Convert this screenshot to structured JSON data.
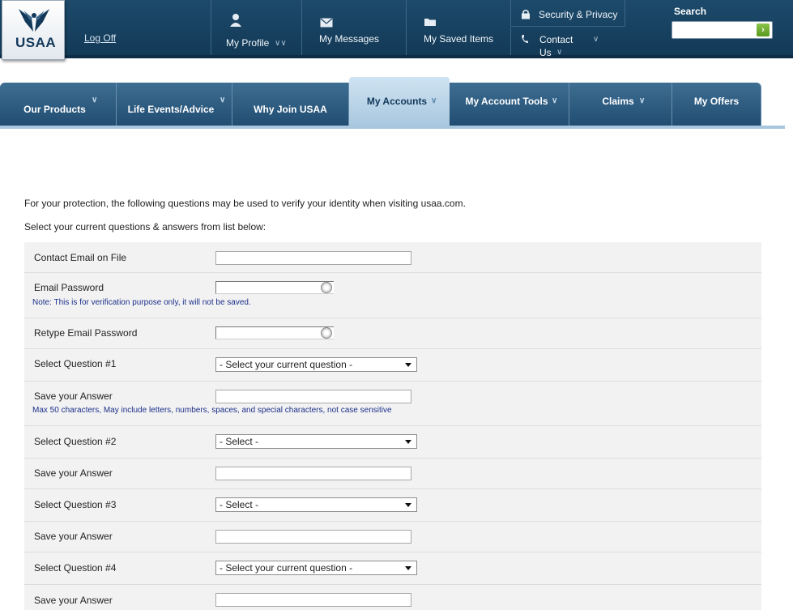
{
  "header": {
    "logo_text": "USAA",
    "logoff_label": "Log Off",
    "nav": [
      {
        "label": "My Profile",
        "icon": "person-icon"
      },
      {
        "label": "My Messages",
        "icon": "envelope-icon"
      },
      {
        "label": "My Saved Items",
        "icon": "folder-icon"
      },
      {
        "label": "Security & Privacy",
        "icon": "lock-icon"
      },
      {
        "label_line1": "Contact",
        "label_line2": "Us",
        "icon": "phone-icon"
      }
    ],
    "search_label": "Search",
    "search_value": ""
  },
  "tabs": [
    {
      "label": "Our Products"
    },
    {
      "label": "Life Events/Advice"
    },
    {
      "label": "Why Join USAA"
    },
    {
      "label": "My Accounts",
      "active": true
    },
    {
      "label": "My Account Tools"
    },
    {
      "label": "Claims"
    },
    {
      "label": "My Offers"
    }
  ],
  "intro": {
    "line1": "For your protection, the following questions may be used to verify your identity when visiting usaa.com.",
    "line2": "Select your current questions & answers from list below:"
  },
  "form": {
    "contact_email": {
      "label": "Contact Email on File",
      "value": ""
    },
    "email_password": {
      "label": "Email Password",
      "note": "Note: This is for verification purpose only, it will not be saved.",
      "value": ""
    },
    "retype_password": {
      "label": "Retype Email Password",
      "value": ""
    },
    "q1": {
      "label": "Select Question #1",
      "selected": "- Select your current question -"
    },
    "a1": {
      "label": "Save your Answer",
      "note": "Max 50 characters, May include letters, numbers, spaces, and special characters, not case sensitive",
      "value": ""
    },
    "q2": {
      "label": "Select Question #2",
      "selected": "- Select -"
    },
    "a2": {
      "label": "Save your Answer",
      "value": ""
    },
    "q3": {
      "label": "Select Question #3",
      "selected": "- Select -"
    },
    "a3": {
      "label": "Save your Answer",
      "value": ""
    },
    "q4": {
      "label": "Select Question #4",
      "selected": "- Select your current question -"
    },
    "a4": {
      "label": "Save your Answer",
      "value": ""
    }
  },
  "colors": {
    "header_bg": "#1d4a6b",
    "tab_bg": "#2f5d82",
    "active_tab_bg": "#bcd6ea",
    "note_color": "#1c2f8a",
    "form_bg": "#f2f2f2"
  }
}
